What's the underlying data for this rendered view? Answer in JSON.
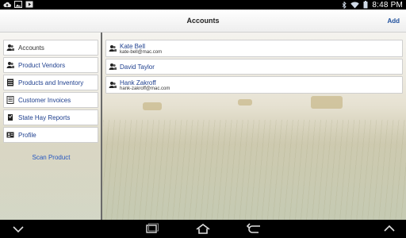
{
  "status_bar": {
    "time": "8:48 PM",
    "left_icons": [
      "upload-cloud-icon",
      "image-icon",
      "video-icon"
    ],
    "right_icons": [
      "bluetooth-icon",
      "wifi-icon",
      "battery-icon"
    ]
  },
  "header": {
    "title": "Accounts",
    "add_label": "Add"
  },
  "sidebar": {
    "items": [
      {
        "label": "Accounts",
        "icon": "accounts-icon",
        "selected": true
      },
      {
        "label": "Product Vendors",
        "icon": "vendors-icon"
      },
      {
        "label": "Products and Inventory",
        "icon": "inventory-icon"
      },
      {
        "label": "Customer Invoices",
        "icon": "invoice-icon"
      },
      {
        "label": "State Hay Reports",
        "icon": "reports-icon"
      },
      {
        "label": "Profile",
        "icon": "profile-icon"
      }
    ],
    "scan_label": "Scan Product"
  },
  "accounts": [
    {
      "name": "Kate Bell",
      "email": "kate-bell@mac.com"
    },
    {
      "name": "David Taylor",
      "email": ""
    },
    {
      "name": "Hank Zakroff",
      "email": "hank-zakroff@mac.com"
    }
  ],
  "nav_bar": {
    "buttons": [
      "back-icon",
      "home-icon",
      "recent-apps-icon",
      "collapse-icon"
    ]
  },
  "colors": {
    "link": "#1e3f8e",
    "accent": "#1e4f9c",
    "scan": "#2556c2"
  }
}
